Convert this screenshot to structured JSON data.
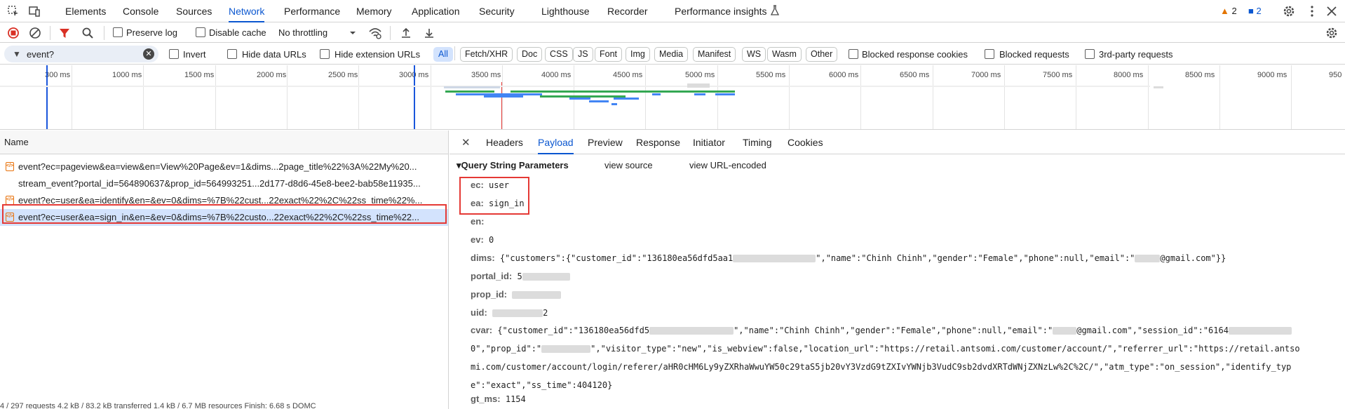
{
  "top_tabs": [
    "Elements",
    "Console",
    "Sources",
    "Network",
    "Performance",
    "Memory",
    "Application",
    "Security",
    "Lighthouse",
    "Recorder",
    "Performance insights"
  ],
  "active_tab": "Network",
  "issues": {
    "warnings": "2",
    "messages": "2"
  },
  "toolbar": {
    "preserve_log": "Preserve log",
    "disable_cache": "Disable cache",
    "throttling": "No throttling"
  },
  "filter": {
    "value": "event?",
    "invert": "Invert",
    "hide_data_urls": "Hide data URLs",
    "hide_extension_urls": "Hide extension URLs",
    "types": [
      "All",
      "Fetch/XHR",
      "Doc",
      "CSS",
      "JS",
      "Font",
      "Img",
      "Media",
      "Manifest",
      "WS",
      "Wasm",
      "Other"
    ],
    "active_type": "All",
    "blocked_response_cookies": "Blocked response cookies",
    "blocked_requests": "Blocked requests",
    "third_party": "3rd-party requests"
  },
  "timeline": {
    "labels": [
      "300 ms",
      "1000 ms",
      "1500 ms",
      "2000 ms",
      "2500 ms",
      "3000 ms",
      "3500 ms",
      "4000 ms",
      "4500 ms",
      "5000 ms",
      "5500 ms",
      "6000 ms",
      "6500 ms",
      "7000 ms",
      "7500 ms",
      "8000 ms",
      "8500 ms",
      "9000 ms",
      "950"
    ]
  },
  "requests": {
    "header": "Name",
    "items": [
      "event?ec=pageview&ea=view&en=View%20Page&ev=1&dims...2page_title%22%3A%22My%20...",
      "stream_event?portal_id=564890637&prop_id=564993251...2d177-d8d6-45e8-bee2-bab58e11935...",
      "event?ec=user&ea=identify&en=&ev=0&dims=%7B%22cust...22exact%22%2C%22ss_time%22%...",
      "event?ec=user&ea=sign_in&en=&ev=0&dims=%7B%22custo...22exact%22%2C%22ss_time%22..."
    ],
    "status": "4 / 297 requests   4.2 kB / 83.2 kB transferred   1.4 kB / 6.7 MB resources   Finish: 6.68 s   DOMC"
  },
  "details": {
    "tabs": [
      "Headers",
      "Payload",
      "Preview",
      "Response",
      "Initiator",
      "Timing",
      "Cookies"
    ],
    "active_tab": "Payload",
    "section_title": "Query String Parameters",
    "view_source": "view source",
    "view_url_encoded": "view URL-encoded",
    "params": [
      {
        "key": "ec:",
        "value": "user"
      },
      {
        "key": "ea:",
        "value": "sign_in"
      },
      {
        "key": "en:",
        "value": ""
      },
      {
        "key": "ev:",
        "value": "0"
      },
      {
        "key": "dims:",
        "value_a": "{\"customers\":{\"customer_id\":\"136180ea56dfd5aa1",
        "value_b": "\",\"name\":\"Chinh Chinh\",\"gender\":\"Female\",\"phone\":null,\"email\":\"",
        "value_c": "@gmail.com\"}}"
      },
      {
        "key": "portal_id:",
        "value": "5"
      },
      {
        "key": "prop_id:",
        "value": ""
      },
      {
        "key": "uid:",
        "value": "2"
      },
      {
        "key": "gt_ms:",
        "value": "1154"
      }
    ],
    "cvar_key": "cvar:",
    "cvar_line1a": "{\"customer_id\":\"136180ea56dfd5",
    "cvar_line1b": "\",\"name\":\"Chinh Chinh\",\"gender\":\"Female\",\"phone\":null,\"email\":\"",
    "cvar_line1c": "@gmail.com\",\"session_id\":\"6164",
    "cvar_line2a": "0\",\"prop_id\":\"",
    "cvar_line2b": "\",\"visitor_type\":\"new\",\"is_webview\":false,\"location_url\":\"https://retail.antsomi.com/customer/account/\",\"referrer_url\":\"https://retail.antso",
    "cvar_line3": "mi.com/customer/account/login/referer/aHR0cHM6Ly9yZXRhaWwuYW50c29taS5jb20vY3VzdG9tZXIvYWNjb3VudC9sb2dvdXRTdWNjZXNzLw%2C%2C/\",\"atm_type\":\"on_session\",\"identify_typ",
    "cvar_line4": "e\":\"exact\",\"ss_time\":404120}"
  }
}
